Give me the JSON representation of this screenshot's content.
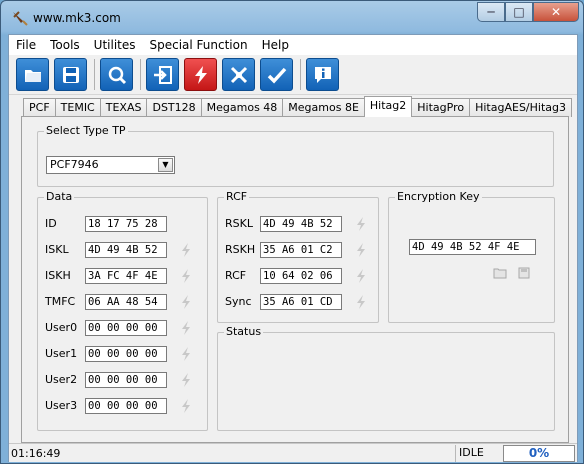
{
  "window": {
    "title": "www.mk3.com",
    "min": "─",
    "max": "□",
    "close": "✕"
  },
  "menu": [
    "File",
    "Tools",
    "Utilites",
    "Special Function",
    "Help"
  ],
  "toolbar": [
    {
      "icon": "folder-icon",
      "color": "blue"
    },
    {
      "icon": "save-icon",
      "color": "blue"
    },
    {
      "icon": "search-icon",
      "color": "blue"
    },
    {
      "icon": "import-icon",
      "color": "blue"
    },
    {
      "icon": "lightning-icon",
      "color": "red"
    },
    {
      "icon": "tools-icon",
      "color": "blue"
    },
    {
      "icon": "check-icon",
      "color": "blue"
    },
    {
      "icon": "info-icon",
      "color": "blue"
    }
  ],
  "tabs": [
    "PCF",
    "TEMIC",
    "TEXAS",
    "DST128",
    "Megamos 48",
    "Megamos 8E",
    "Hitag2",
    "HitagPro",
    "HitagAES/Hitag3"
  ],
  "active_tab": "Hitag2",
  "select_type": {
    "title": "Select Type TP",
    "value": "PCF7946",
    "arrow": "▼"
  },
  "data_group": {
    "title": "Data",
    "rows": [
      {
        "label": "ID",
        "value": "18 17 75 28"
      },
      {
        "label": "ISKL",
        "value": "4D 49 4B 52"
      },
      {
        "label": "ISKH",
        "value": "3A FC 4F 4E"
      },
      {
        "label": "TMFC",
        "value": "06 AA 48 54"
      },
      {
        "label": "User0",
        "value": "00 00 00 00"
      },
      {
        "label": "User1",
        "value": "00 00 00 00"
      },
      {
        "label": "User2",
        "value": "00 00 00 00"
      },
      {
        "label": "User3",
        "value": "00 00 00 00"
      }
    ]
  },
  "rcf_group": {
    "title": "RCF",
    "rows": [
      {
        "label": "RSKL",
        "value": "4D 49 4B 52"
      },
      {
        "label": "RSKH",
        "value": "35 A6 01 C2"
      },
      {
        "label": "RCF",
        "value": "10 64 02 06"
      },
      {
        "label": "Sync",
        "value": "35 A6 01 CD"
      }
    ]
  },
  "encryption_group": {
    "title": "Encryption Key",
    "value": "4D 49 4B 52 4F 4E"
  },
  "status_group": {
    "title": "Status"
  },
  "statusbar": {
    "time": "01:16:49",
    "state": "IDLE",
    "progress": "0%"
  },
  "colors": {
    "accent": "#1262b6",
    "danger": "#c41616",
    "progress_text": "#2060c0"
  }
}
